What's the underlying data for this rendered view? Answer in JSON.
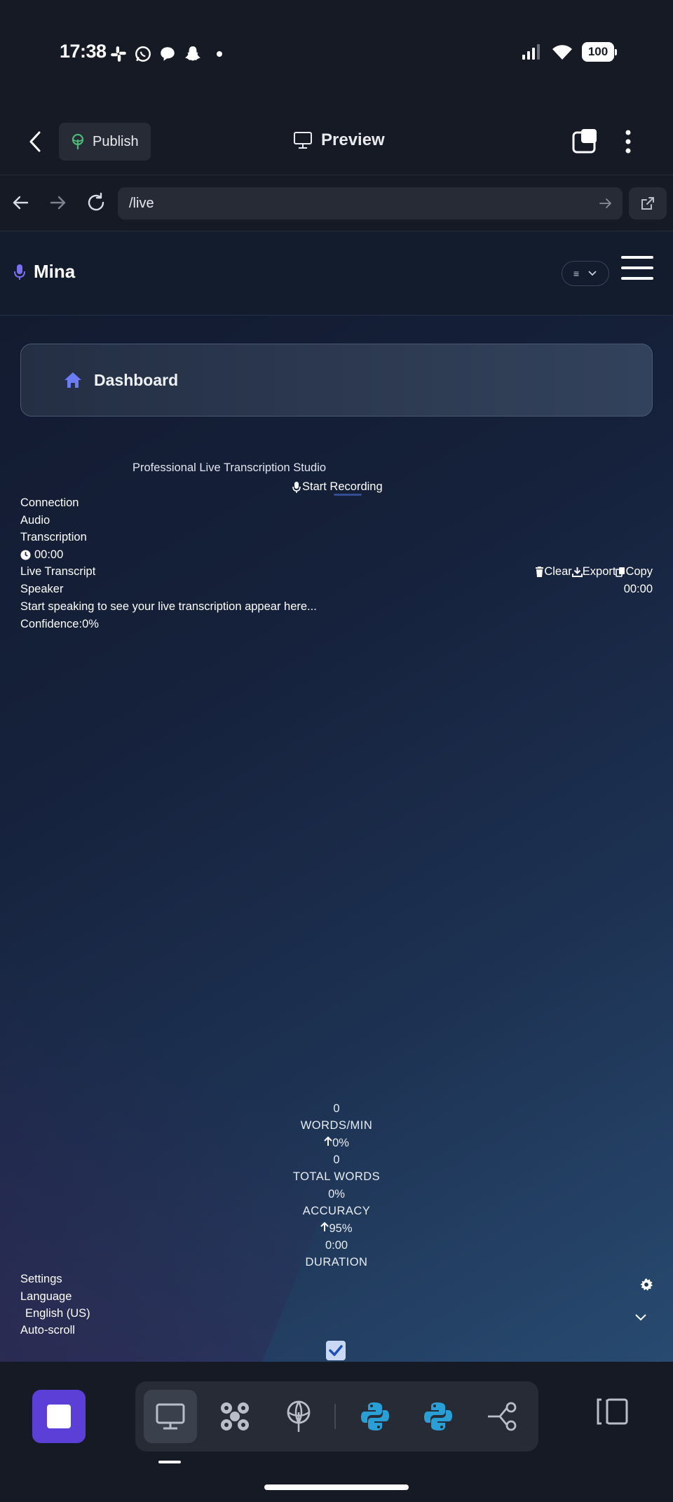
{
  "status_bar": {
    "time": "17:38",
    "battery": "100",
    "notification_icons": [
      "slack-icon",
      "whatsapp-icon",
      "messenger-icon",
      "snapchat-icon",
      "dot-icon"
    ],
    "system_icons": [
      "cellular-signal-icon",
      "wifi-icon",
      "battery-icon"
    ]
  },
  "app_header": {
    "publish_label": "Publish",
    "preview_label": "Preview"
  },
  "browser": {
    "url": "/live"
  },
  "site_nav": {
    "brand": "Mina",
    "lang_select_icon": "≡"
  },
  "dashboard": {
    "label": "Dashboard"
  },
  "studio": {
    "subtitle": "Professional Live Transcription Studio",
    "start_recording": "Start Recording",
    "status_items": [
      "Connection",
      "Audio",
      "Transcription"
    ],
    "timer": "00:00",
    "transcript_title": "Live Transcript",
    "actions": {
      "clear": "Clear",
      "export": "Export",
      "copy": "Copy"
    },
    "speaker_label": "Speaker",
    "speaker_time": "00:00",
    "placeholder": "Start speaking to see your live transcription appear here...",
    "confidence_label": "Confidence:",
    "confidence_value": "0%"
  },
  "stats": {
    "words_per_min_value": "0",
    "words_per_min_label": "WORDS/MIN",
    "words_per_min_change": "0%",
    "total_words_value": "0",
    "total_words_label": "TOTAL WORDS",
    "total_words_change": "0%",
    "accuracy_label": "ACCURACY",
    "accuracy_value": "95%",
    "duration_value": "0:00",
    "duration_label": "DURATION"
  },
  "settings": {
    "title": "Settings",
    "language_label": "Language",
    "language_value": "English (US)",
    "autoscroll_label": "Auto-scroll",
    "autoscroll_checked": true
  },
  "toolbar": {
    "tools": [
      "desktop-icon",
      "extensions-icon",
      "deploy-icon",
      "python-icon",
      "python-icon",
      "share-node-icon"
    ]
  },
  "colors": {
    "accent": "#5b3fd6",
    "brand_icon": "#7b6ff0",
    "publish_icon": "#4cb878",
    "python_blue": "#2a9fd6"
  }
}
